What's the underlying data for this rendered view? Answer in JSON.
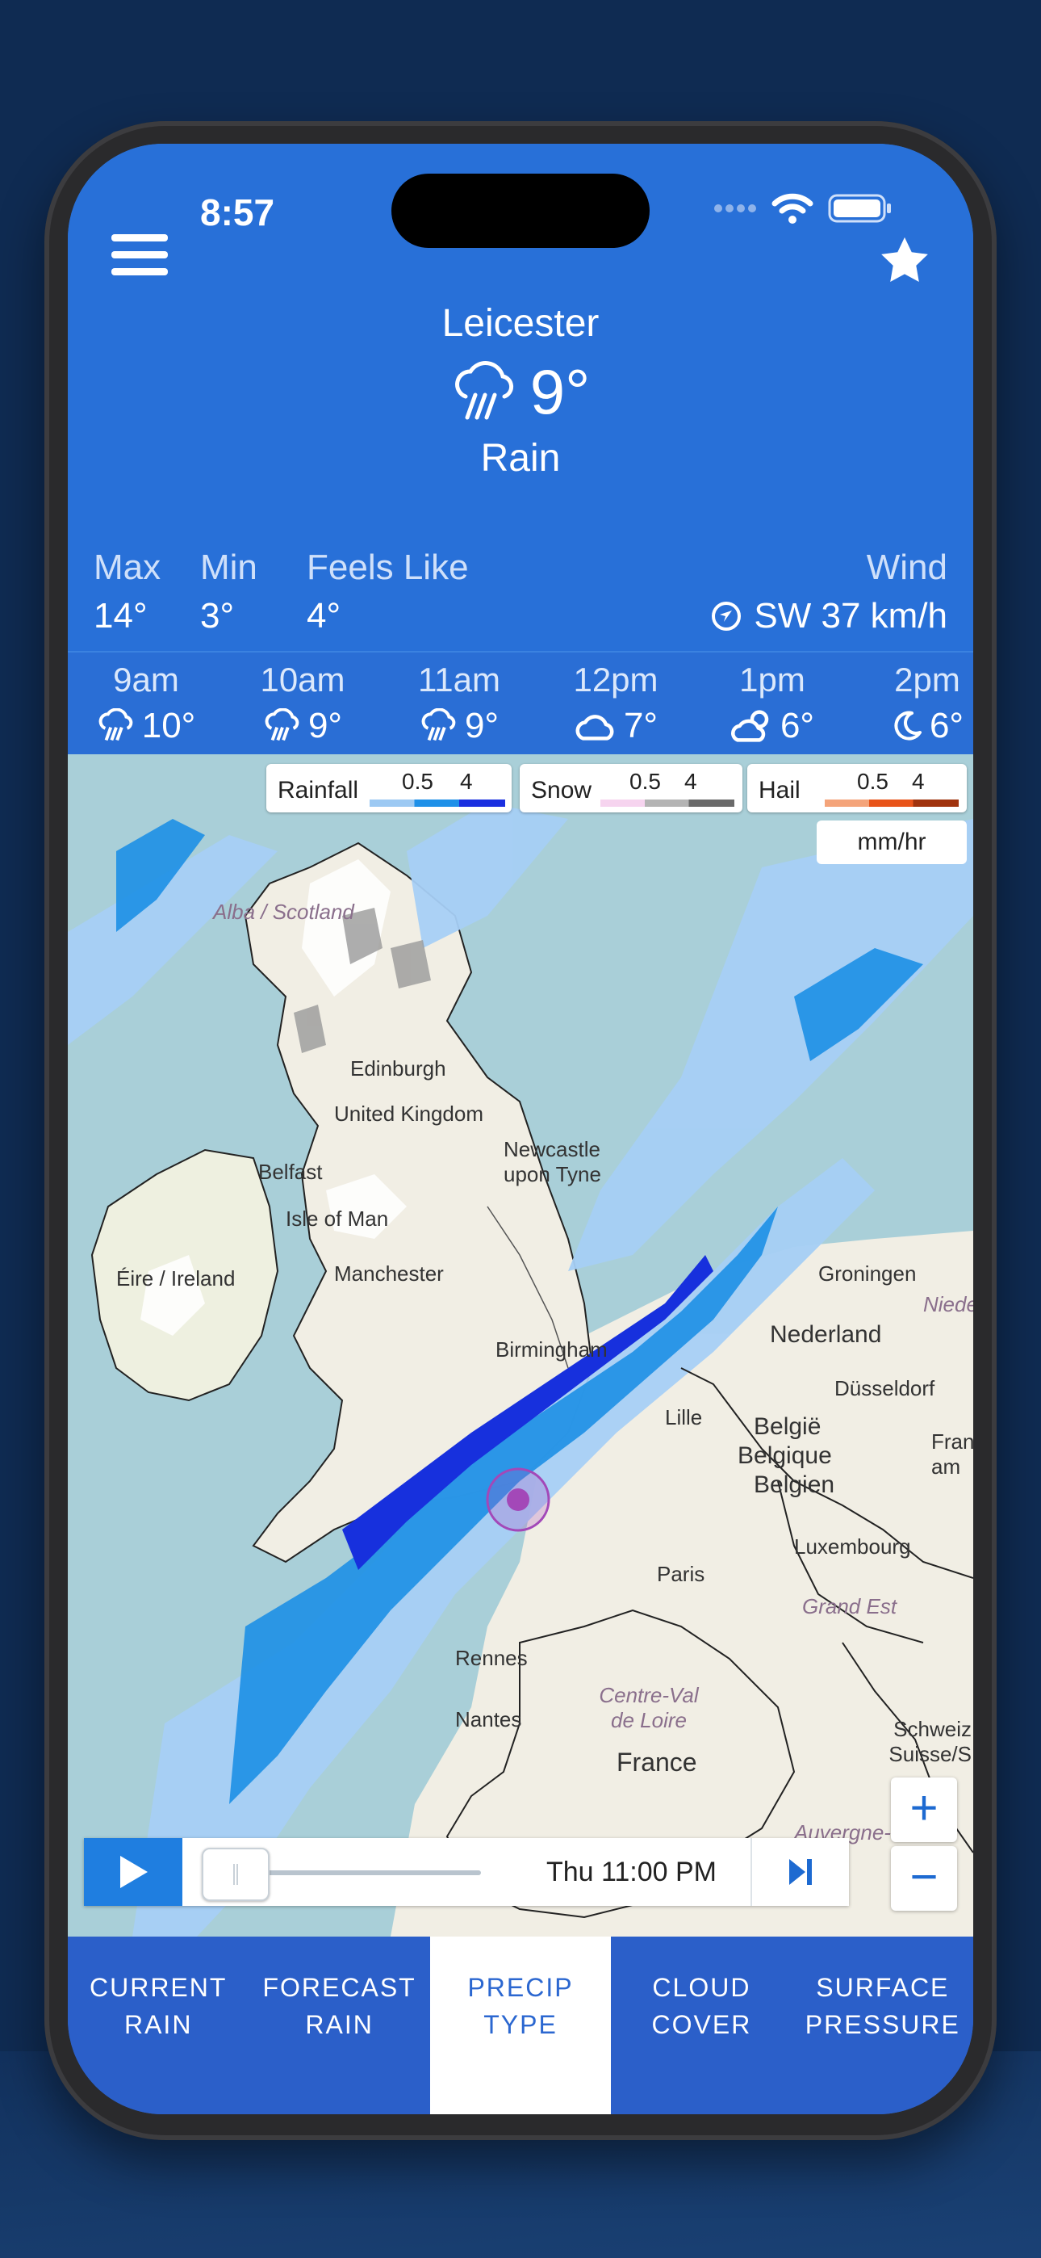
{
  "status_bar": {
    "time": "8:57"
  },
  "header": {
    "location": "Leicester",
    "current_temp": "9°",
    "condition": "Rain",
    "stats": [
      {
        "label": "Max",
        "value": "14°"
      },
      {
        "label": "Min",
        "value": "3°"
      },
      {
        "label": "Feels Like",
        "value": "4°"
      }
    ],
    "wind": {
      "label": "Wind",
      "value": "SW 37 km/h"
    }
  },
  "hourly": [
    {
      "time": "9am",
      "temp": "10°",
      "icon": "rain-icon"
    },
    {
      "time": "10am",
      "temp": "9°",
      "icon": "rain-icon"
    },
    {
      "time": "11am",
      "temp": "9°",
      "icon": "rain-icon"
    },
    {
      "time": "12pm",
      "temp": "7°",
      "icon": "cloud-icon"
    },
    {
      "time": "1pm",
      "temp": "6°",
      "icon": "partly-cloudy-icon"
    },
    {
      "time": "2pm",
      "temp": "6°",
      "icon": "moon-icon"
    }
  ],
  "map": {
    "legends": [
      {
        "name": "Rainfall",
        "low": "0.5",
        "high": "4",
        "colors": [
          "#9cc9f3",
          "#1e90e8",
          "#1a2fe0"
        ]
      },
      {
        "name": "Snow",
        "low": "0.5",
        "high": "4",
        "colors": [
          "#f6d4ef",
          "#b4b4b4",
          "#6a6a6a"
        ]
      },
      {
        "name": "Hail",
        "low": "0.5",
        "high": "4",
        "colors": [
          "#f4a47a",
          "#e8541a",
          "#a0330e"
        ]
      }
    ],
    "unit": "mm/hr",
    "place_labels": {
      "edinburgh": "Edinburgh",
      "united_kingdom": "United Kingdom",
      "newcastle": "Newcastle upon Tyne",
      "belfast": "Belfast",
      "isle_of_man": "Isle of Man",
      "manchester": "Manchester",
      "ireland": "Éire / Ireland",
      "birmingham": "Birmingham",
      "groningen": "Groningen",
      "niedersachsen": "Nieder",
      "nederland": "Nederland",
      "dusseldorf": "Düsseldorf",
      "lille": "Lille",
      "belgie": "België",
      "belgique": "Belgique",
      "belgien": "Belgien",
      "frankfurt": "Frankfurt am",
      "luxembourg": "Luxembourg",
      "paris": "Paris",
      "grand_est": "Grand Est",
      "rennes": "Rennes",
      "centre_val": "Centre-Val de Loire",
      "nantes": "Nantes",
      "france": "France",
      "schweiz": "Schweiz Suisse/S",
      "auvergne": "Auvergne-",
      "alba": "Alba / Scotland"
    },
    "zoom_in": "+",
    "zoom_out": "−",
    "playback": {
      "time_label": "Thu 11:00 PM",
      "progress": 0.0
    }
  },
  "tabs": [
    {
      "line1": "CURRENT",
      "line2": "RAIN",
      "active": false
    },
    {
      "line1": "FORECAST",
      "line2": "RAIN",
      "active": false
    },
    {
      "line1": "PRECIP",
      "line2": "TYPE",
      "active": true
    },
    {
      "line1": "CLOUD",
      "line2": "COVER",
      "active": false
    },
    {
      "line1": "SURFACE",
      "line2": "PRESSURE",
      "active": false
    }
  ]
}
